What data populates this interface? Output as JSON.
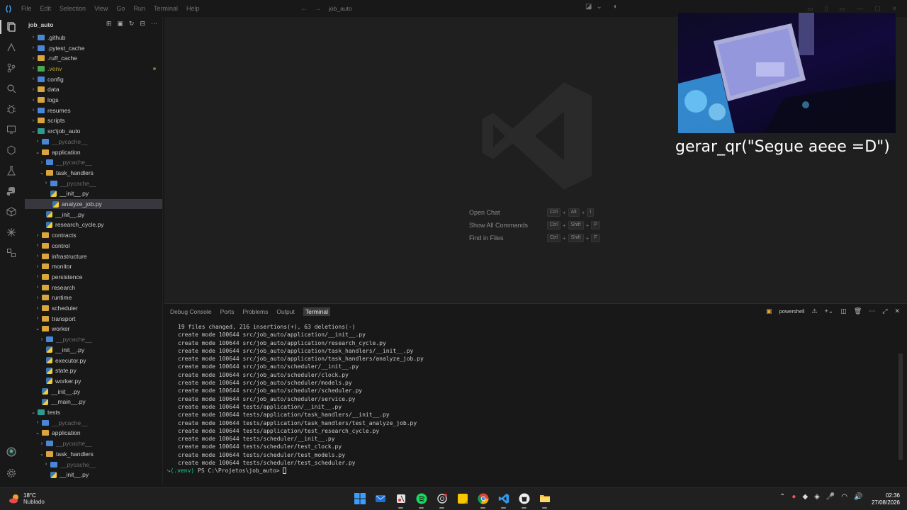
{
  "titlebar": {
    "menus": [
      "File",
      "Edit",
      "Selection",
      "View",
      "Go",
      "Run",
      "Terminal",
      "Help"
    ],
    "search_text": "job_auto"
  },
  "activitybar": {
    "icons": [
      "explorer-icon",
      "search-icon",
      "source-control-icon",
      "search-alt-icon",
      "debug-icon",
      "remote-explorer-icon",
      "extensions-icon",
      "testing-icon",
      "python-icon",
      "containers-icon",
      "settings-sync-icon",
      "misc-icon"
    ],
    "bottom_icons": [
      "account-icon",
      "settings-gear-icon"
    ]
  },
  "explorer": {
    "title": "job_auto",
    "rows": [
      {
        "label": ".github",
        "depth": 0,
        "chevron": "›",
        "icon": "folder-blue",
        "style": ""
      },
      {
        "label": ".pytest_cache",
        "depth": 0,
        "chevron": "›",
        "icon": "folder-blue",
        "style": ""
      },
      {
        "label": ".ruff_cache",
        "depth": 0,
        "chevron": "›",
        "icon": "folder",
        "style": ""
      },
      {
        "label": ".venv",
        "depth": 0,
        "chevron": "›",
        "icon": "folder-green",
        "style": "venv",
        "dot": true
      },
      {
        "label": "config",
        "depth": 0,
        "chevron": "›",
        "icon": "folder-blue",
        "style": ""
      },
      {
        "label": "data",
        "depth": 0,
        "chevron": "›",
        "icon": "folder",
        "style": ""
      },
      {
        "label": "logs",
        "depth": 0,
        "chevron": "›",
        "icon": "folder",
        "style": ""
      },
      {
        "label": "resumes",
        "depth": 0,
        "chevron": "›",
        "icon": "folder-blue",
        "style": ""
      },
      {
        "label": "scripts",
        "depth": 0,
        "chevron": "›",
        "icon": "folder",
        "style": ""
      },
      {
        "label": "src\\job_auto",
        "depth": 0,
        "chevron": "⌄",
        "icon": "folder-teal",
        "style": ""
      },
      {
        "label": "__pycache__",
        "depth": 1,
        "chevron": "›",
        "icon": "folder-blue",
        "style": "dim"
      },
      {
        "label": "application",
        "depth": 1,
        "chevron": "⌄",
        "icon": "folder",
        "style": ""
      },
      {
        "label": "__pycache__",
        "depth": 2,
        "chevron": "›",
        "icon": "folder-blue",
        "style": "dim"
      },
      {
        "label": "task_handlers",
        "depth": 2,
        "chevron": "⌄",
        "icon": "folder",
        "style": ""
      },
      {
        "label": "__pycache__",
        "depth": 3,
        "chevron": "›",
        "icon": "folder-blue",
        "style": "dim"
      },
      {
        "label": "__init__.py",
        "depth": 3,
        "chevron": "",
        "icon": "py",
        "style": ""
      },
      {
        "label": "analyze_job.py",
        "depth": 3,
        "chevron": "",
        "icon": "py",
        "style": "",
        "selected": true
      },
      {
        "label": "__init__.py",
        "depth": 2,
        "chevron": "",
        "icon": "py",
        "style": ""
      },
      {
        "label": "research_cycle.py",
        "depth": 2,
        "chevron": "",
        "icon": "py",
        "style": ""
      },
      {
        "label": "contracts",
        "depth": 1,
        "chevron": "›",
        "icon": "folder",
        "style": ""
      },
      {
        "label": "control",
        "depth": 1,
        "chevron": "›",
        "icon": "folder",
        "style": ""
      },
      {
        "label": "infrastructure",
        "depth": 1,
        "chevron": "›",
        "icon": "folder",
        "style": ""
      },
      {
        "label": "monitor",
        "depth": 1,
        "chevron": "›",
        "icon": "folder",
        "style": ""
      },
      {
        "label": "persistence",
        "depth": 1,
        "chevron": "›",
        "icon": "folder",
        "style": ""
      },
      {
        "label": "research",
        "depth": 1,
        "chevron": "›",
        "icon": "folder",
        "style": ""
      },
      {
        "label": "runtime",
        "depth": 1,
        "chevron": "›",
        "icon": "folder",
        "style": ""
      },
      {
        "label": "scheduler",
        "depth": 1,
        "chevron": "›",
        "icon": "folder",
        "style": ""
      },
      {
        "label": "transport",
        "depth": 1,
        "chevron": "›",
        "icon": "folder",
        "style": ""
      },
      {
        "label": "worker",
        "depth": 1,
        "chevron": "⌄",
        "icon": "folder",
        "style": ""
      },
      {
        "label": "__pycache__",
        "depth": 2,
        "chevron": "›",
        "icon": "folder-blue",
        "style": "dim"
      },
      {
        "label": "__init__.py",
        "depth": 2,
        "chevron": "",
        "icon": "py",
        "style": ""
      },
      {
        "label": "executor.py",
        "depth": 2,
        "chevron": "",
        "icon": "py",
        "style": ""
      },
      {
        "label": "state.py",
        "depth": 2,
        "chevron": "",
        "icon": "py",
        "style": ""
      },
      {
        "label": "worker.py",
        "depth": 2,
        "chevron": "",
        "icon": "py",
        "style": ""
      },
      {
        "label": "__init__.py",
        "depth": 1,
        "chevron": "",
        "icon": "py",
        "style": ""
      },
      {
        "label": "__main__.py",
        "depth": 1,
        "chevron": "",
        "icon": "py",
        "style": ""
      },
      {
        "label": "tests",
        "depth": 0,
        "chevron": "⌄",
        "icon": "folder-teal",
        "style": ""
      },
      {
        "label": "__pycache__",
        "depth": 1,
        "chevron": "›",
        "icon": "folder-blue",
        "style": "dim"
      },
      {
        "label": "application",
        "depth": 1,
        "chevron": "⌄",
        "icon": "folder",
        "style": ""
      },
      {
        "label": "__pycache__",
        "depth": 2,
        "chevron": "›",
        "icon": "folder-blue",
        "style": "dim"
      },
      {
        "label": "task_handlers",
        "depth": 2,
        "chevron": "⌄",
        "icon": "folder",
        "style": ""
      },
      {
        "label": "__pycache__",
        "depth": 3,
        "chevron": "›",
        "icon": "folder-blue",
        "style": "dim"
      },
      {
        "label": "__init__.py",
        "depth": 3,
        "chevron": "",
        "icon": "py",
        "style": ""
      }
    ]
  },
  "editor": {
    "shortcuts": [
      {
        "label": "Open Chat",
        "keys": [
          "Ctrl",
          "Alt",
          "I"
        ]
      },
      {
        "label": "Show All Commands",
        "keys": [
          "Ctrl",
          "Shift",
          "P"
        ]
      },
      {
        "label": "Find in Files",
        "keys": [
          "Ctrl",
          "Shift",
          "F"
        ]
      }
    ]
  },
  "overlay": {
    "caption": "gerar_qr(\"Segue aeee =D\")"
  },
  "panel": {
    "tabs": [
      "Debug Console",
      "Ports",
      "Problems",
      "Output",
      "Terminal"
    ],
    "active_tab": "Terminal",
    "terminal_profile": "powershell",
    "output_lines": [
      "19 files changed, 216 insertions(+), 63 deletions(-)",
      "create mode 100644 src/job_auto/application/__init__.py",
      "create mode 100644 src/job_auto/application/research_cycle.py",
      "create mode 100644 src/job_auto/application/task_handlers/__init__.py",
      "create mode 100644 src/job_auto/application/task_handlers/analyze_job.py",
      "create mode 100644 src/job_auto/scheduler/__init__.py",
      "create mode 100644 src/job_auto/scheduler/clock.py",
      "create mode 100644 src/job_auto/scheduler/models.py",
      "create mode 100644 src/job_auto/scheduler/scheduler.py",
      "create mode 100644 src/job_auto/scheduler/service.py",
      "create mode 100644 tests/application/__init__.py",
      "create mode 100644 tests/application/task_handlers/__init__.py",
      "create mode 100644 tests/application/task_handlers/test_analyze_job.py",
      "create mode 100644 tests/application/test_research_cycle.py",
      "create mode 100644 tests/scheduler/__init__.py",
      "create mode 100644 tests/scheduler/test_clock.py",
      "create mode 100644 tests/scheduler/test_models.py",
      "create mode 100644 tests/scheduler/test_scheduler.py"
    ],
    "prompt_prefix": "(.venv)",
    "prompt": "PS C:\\Projetos\\job_auto> "
  },
  "taskbar": {
    "weather_temp": "18°C",
    "weather_condition": "Nublado",
    "apps": [
      "windows-start-icon",
      "outlook-icon",
      "snipping-tool-icon",
      "spotify-icon",
      "chatgpt-icon",
      "sticky-notes-icon",
      "chrome-icon",
      "vscode-icon",
      "github-icon",
      "file-explorer-icon"
    ],
    "time": "02:36",
    "date": "27/08/2026"
  },
  "colors": {
    "accent": "#0078d4",
    "venv_prompt": "#23d18b",
    "caption_text": "#ffffff"
  }
}
